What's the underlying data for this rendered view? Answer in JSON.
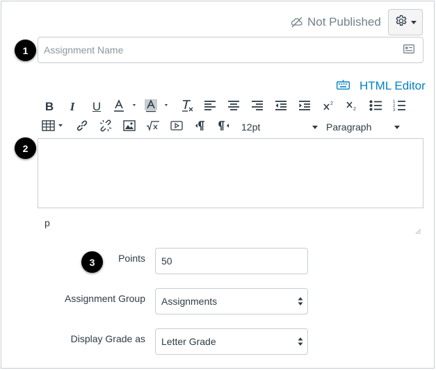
{
  "status": {
    "label": "Not Published",
    "icon": "unpublished-cloud-icon"
  },
  "settings": {
    "icon": "gear-icon"
  },
  "badges": {
    "one": "1",
    "two": "2",
    "three": "3"
  },
  "assignment_name": {
    "placeholder": "Assignment Name",
    "value": ""
  },
  "editor": {
    "html_editor_label": "HTML Editor",
    "bold": "B",
    "italic": "I",
    "underline": "U",
    "font_size": "12pt",
    "format": "Paragraph",
    "path": "p"
  },
  "form": {
    "points_label": "Points",
    "points_value": "50",
    "group_label": "Assignment Group",
    "group_value": "Assignments",
    "display_label": "Display Grade as",
    "display_value": "Letter Grade"
  },
  "colors": {
    "link": "#0081c6",
    "text": "#2d3b45",
    "muted": "#73818c",
    "border": "#c7cdd1"
  }
}
